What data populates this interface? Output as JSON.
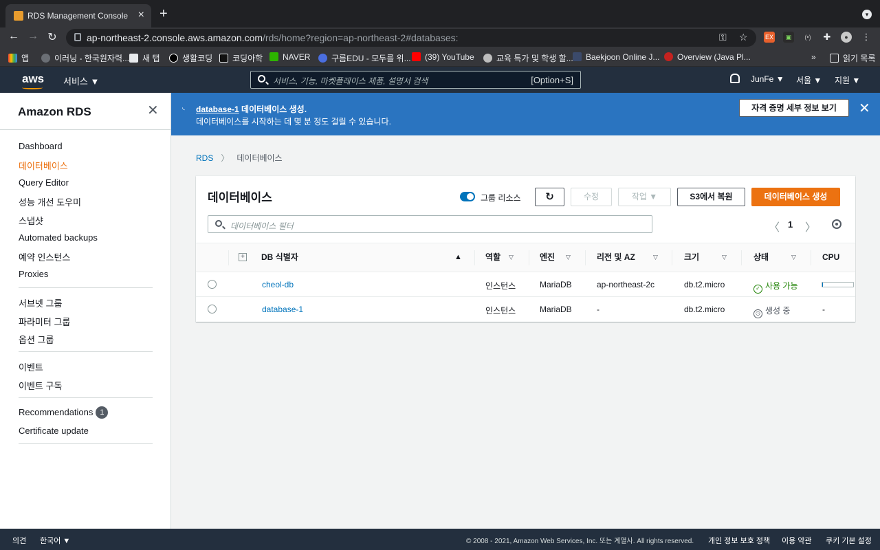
{
  "browser": {
    "tab_title": "RDS Management Console",
    "url_host": "ap-northeast-2.console.aws.amazon.com",
    "url_path": "/rds/home?region=ap-northeast-2#databases:",
    "bookmarks": [
      "앱",
      "이러닝 - 한국원자력...",
      "새 탭",
      "생활코딩",
      "코딩아학",
      "NAVER",
      "구름EDU - 모두를 위...",
      "(39) YouTube",
      "교육 특가 및 학생 할...",
      "Baekjoon Online J...",
      "Overview (Java Pl..."
    ],
    "bookmarks_more": "»",
    "reading_list": "읽기 목록"
  },
  "aws_header": {
    "logo": "aws",
    "services": "서비스",
    "search_placeholder": "서비스, 기능, 마켓플레이스 제품, 설명서 검색",
    "search_shortcut": "[Option+S]",
    "user": "JunFe",
    "region": "서울",
    "support": "지원"
  },
  "sidebar": {
    "title": "Amazon RDS",
    "groups": [
      [
        "Dashboard",
        "데이터베이스",
        "Query Editor",
        "성능 개선 도우미",
        "스냅샷",
        "Automated backups",
        "예약 인스턴스",
        "Proxies"
      ],
      [
        "서브넷 그룹",
        "파라미터 그룹",
        "옵션 그룹"
      ],
      [
        "이벤트",
        "이벤트 구독"
      ],
      [
        "Recommendations",
        "Certificate update"
      ]
    ],
    "active": "데이터베이스",
    "recommendations_badge": "1"
  },
  "flash": {
    "db_link": "database-1",
    "line1_suffix": " 데이터베이스 생성.",
    "line2": "데이터베이스를 시작하는 데 몇 분 정도 걸릴 수 있습니다.",
    "button": "자격 증명 세부 정보 보기"
  },
  "breadcrumb": {
    "root": "RDS",
    "current": "데이터베이스"
  },
  "panel": {
    "title": "데이터베이스",
    "group_resources_label": "그룹 리소스",
    "group_resources_on": true,
    "modify": "수정",
    "actions": "작업",
    "restore_s3": "S3에서 복원",
    "create": "데이터베이스 생성",
    "filter_placeholder": "데이터베이스 필터",
    "page": "1"
  },
  "table": {
    "columns": [
      "DB 식별자",
      "역할",
      "엔진",
      "리전 및 AZ",
      "크기",
      "상태",
      "CPU"
    ],
    "rows": [
      {
        "id": "cheol-db",
        "role": "인스턴스",
        "engine": "MariaDB",
        "region": "ap-northeast-2c",
        "size": "db.t2.micro",
        "status": "사용 가능",
        "cpu": 0.03
      },
      {
        "id": "database-1",
        "role": "인스턴스",
        "engine": "MariaDB",
        "region": "-",
        "size": "db.t2.micro",
        "status": "생성 중",
        "cpu": "-"
      }
    ]
  },
  "footer": {
    "feedback": "의견",
    "language": "한국어",
    "copyright": "© 2008 - 2021, Amazon Web Services, Inc. 또는 계열사. All rights reserved.",
    "privacy": "개인 정보 보호 정책",
    "terms": "이용 약관",
    "cookies": "쿠키 기본 설정"
  },
  "colors": {
    "accent": "#ec7211",
    "link": "#0073bb",
    "flash_bg": "#2a74c0",
    "header_bg": "#232f3e",
    "available": "#1d8102"
  }
}
